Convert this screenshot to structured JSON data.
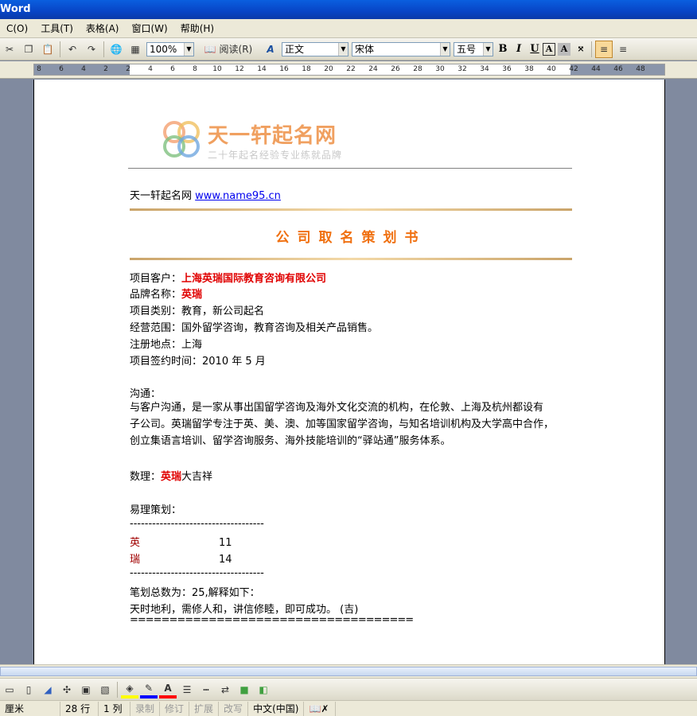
{
  "window": {
    "title": "Word"
  },
  "menu": [
    {
      "label": "C(O)"
    },
    {
      "label": "工具(T)"
    },
    {
      "label": "表格(A)"
    },
    {
      "label": "窗口(W)"
    },
    {
      "label": "帮助(H)"
    }
  ],
  "toolbar": {
    "zoom": "100%",
    "read_label": "阅读(R)",
    "style": "正文",
    "font": "宋体",
    "size": "五号",
    "bold": "B",
    "italic": "I",
    "underline": "U"
  },
  "ruler": {
    "ticks": [
      "8",
      "6",
      "4",
      "2",
      "2",
      "4",
      "6",
      "8",
      "10",
      "12",
      "14",
      "16",
      "18",
      "20",
      "22",
      "24",
      "26",
      "28",
      "30",
      "32",
      "34",
      "36",
      "38",
      "40",
      "42",
      "44",
      "46",
      "48"
    ]
  },
  "document": {
    "logo_text": "天一轩起名网",
    "logo_sub": "二十年起名经验专业练就品牌",
    "site_prefix": "天一轩起名网",
    "site_link": "www.name95.cn",
    "title": "公司取名策划书",
    "fields": [
      {
        "label": "项目客户：",
        "value": "上海英瑞国际教育咨询有限公司",
        "highlight": true
      },
      {
        "label": "品牌名称：",
        "value": "英瑞",
        "highlight": true
      },
      {
        "label": "项目类别：",
        "value": "教育，新公司起名",
        "highlight": false
      },
      {
        "label": "经营范围：",
        "value": "国外留学咨询，教育咨询及相关产品销售。",
        "highlight": false
      },
      {
        "label": "注册地点：",
        "value": "上海",
        "highlight": false
      },
      {
        "label": "项目签约时间：",
        "value": "2010 年 5 月",
        "highlight": false
      }
    ],
    "comm_heading": "沟通：",
    "comm_lines": [
      "与客户沟通，是一家从事出国留学咨询及海外文化交流的机构，在伦敦、上海及杭州都设有",
      "子公司。英瑞留学专注于英、美、澳、加等国家留学咨询，与知名培训机构及大学高中合作，",
      "创立集语言培训、留学咨询服务、海外技能培训的“驿站通”服务体系。"
    ],
    "shuli_label": "数理：",
    "shuli_name": "英瑞",
    "shuli_result": "大吉祥",
    "yili_heading": "易理策划：",
    "dashes": "------------------------------------",
    "strokes": [
      {
        "char": "英",
        "count": "11"
      },
      {
        "char": "瑞",
        "count": "14"
      }
    ],
    "total_line": "笔划总数为：25,解释如下：",
    "explain_line": "天时地利，需修人和，讲信修睦，即可成功。 (吉)",
    "equals": "===================================="
  },
  "status": {
    "unit": "厘米",
    "row": "28 行",
    "col": "1 列",
    "rec": "录制",
    "trk": "修订",
    "ext": "扩展",
    "ovr": "改写",
    "lang": "中文(中国)"
  },
  "colors": {
    "title_orange": "#f07010",
    "highlight_red": "#e00000",
    "link_blue": "#0000ee"
  }
}
